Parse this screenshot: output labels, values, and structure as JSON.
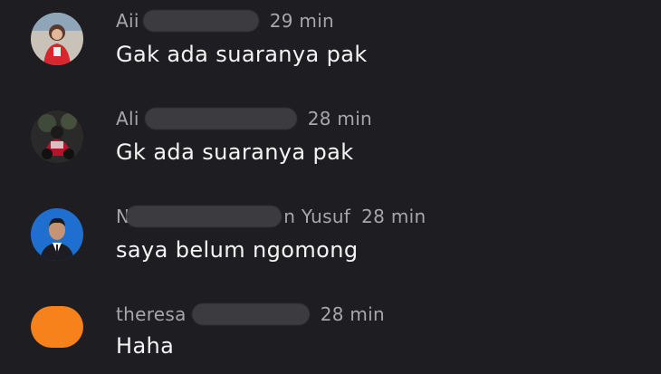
{
  "comments": [
    {
      "author": "Aii",
      "author_suffix": "",
      "time": "29 min",
      "text": "Gak ada suaranya pak",
      "avatar": "photo-girl-red-avatar"
    },
    {
      "author": "Ali",
      "author_suffix": "",
      "time": "28 min",
      "text": "Gk ada suaranya pak",
      "avatar": "photo-motorbike-avatar"
    },
    {
      "author": "N",
      "author_suffix": "n Yusuf",
      "time": "28 min",
      "text": "saya belum ngomong",
      "avatar": "photo-man-blue-background-avatar"
    },
    {
      "author": "theresa",
      "author_suffix": "",
      "time": "28 min",
      "text": "Haha",
      "avatar": "orange-placeholder-avatar"
    }
  ],
  "colors": {
    "background": "#1e1e22",
    "meta_text": "#a6a6ab",
    "body_text": "#f4f4f4",
    "redaction": "#3b3b40",
    "orange_avatar": "#f7821b"
  }
}
